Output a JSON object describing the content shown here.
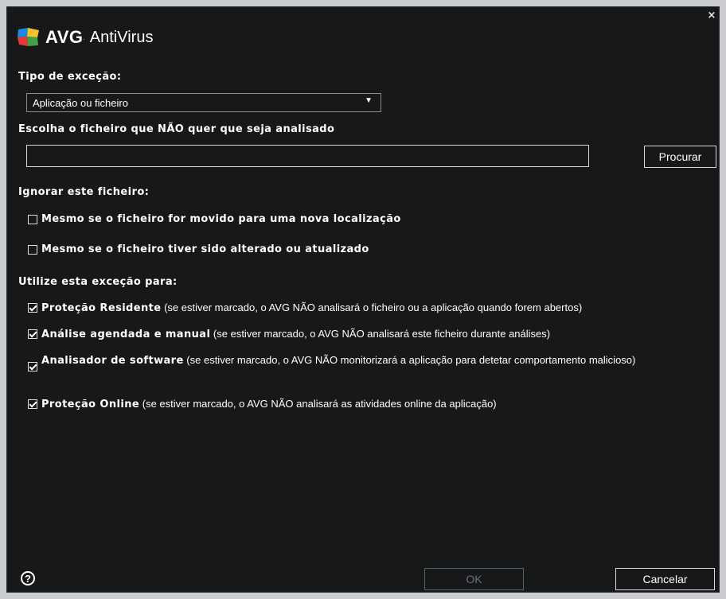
{
  "app": {
    "brand": "AVG",
    "brand_mark": ".",
    "product": "AntiVirus",
    "close_glyph": "×"
  },
  "exception_type": {
    "label": "Tipo de exceção:",
    "selected": "Aplicação ou ficheiro",
    "arrow": "▼"
  },
  "file_choice": {
    "label": "Escolha o ficheiro que NÃO quer que seja analisado",
    "value": "",
    "browse_label": "Procurar"
  },
  "ignore": {
    "label": "Ignorar este ficheiro:",
    "options": [
      {
        "text": "Mesmo se o ficheiro for movido para uma nova localização",
        "checked": false
      },
      {
        "text": "Mesmo se o ficheiro tiver sido alterado ou atualizado",
        "checked": false
      }
    ]
  },
  "use_for": {
    "label": "Utilize esta exceção para:",
    "options": [
      {
        "title": "Proteção Residente",
        "desc": " (se estiver marcado, o AVG NÃO analisará o ficheiro ou a aplicação quando forem abertos)",
        "checked": true
      },
      {
        "title": "Análise agendada e manual",
        "desc": " (se estiver marcado, o AVG NÃO analisará este ficheiro durante análises)",
        "checked": true
      },
      {
        "title": "Analisador de software",
        "desc": " (se estiver marcado, o AVG NÃO monitorizará a aplicação para detetar comportamento malicioso)",
        "checked": true
      },
      {
        "title": "Proteção Online",
        "desc": " (se estiver marcado, o AVG NÃO analisará as atividades online da aplicação)",
        "checked": true
      }
    ]
  },
  "footer": {
    "help_glyph": "?",
    "ok_label": "OK",
    "ok_enabled": false,
    "cancel_label": "Cancelar"
  },
  "colors": {
    "background": "#161819",
    "text": "#ffffff",
    "border": "#d8d8d8",
    "disabled": "#6d7073"
  }
}
